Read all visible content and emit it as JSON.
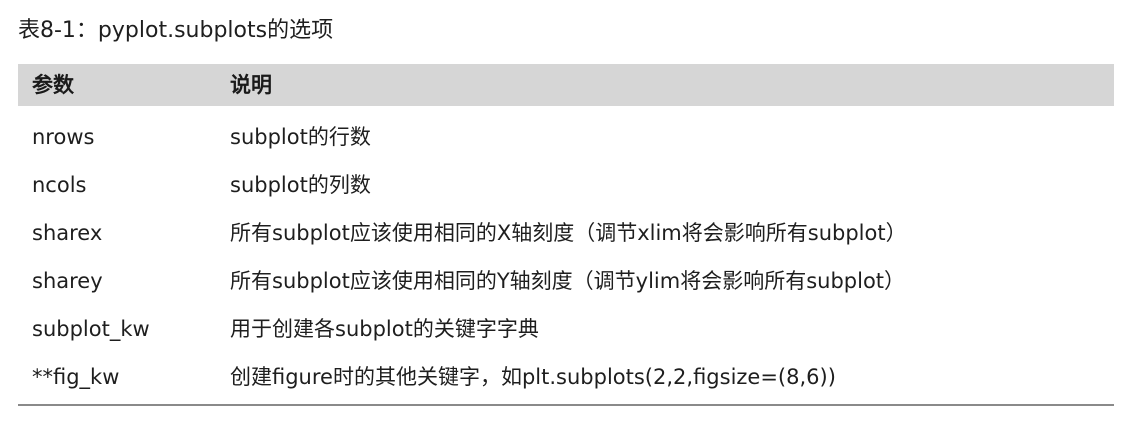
{
  "caption": "表8-1：pyplot.subplots的选项",
  "table": {
    "headers": [
      "参数",
      "说明"
    ],
    "rows": [
      {
        "param": "nrows",
        "desc": "subplot的行数"
      },
      {
        "param": "ncols",
        "desc": "subplot的列数"
      },
      {
        "param": "sharex",
        "desc": "所有subplot应该使用相同的X轴刻度（调节xlim将会影响所有subplot）"
      },
      {
        "param": "sharey",
        "desc": "所有subplot应该使用相同的Y轴刻度（调节ylim将会影响所有subplot）"
      },
      {
        "param": "subplot_kw",
        "desc": "用于创建各subplot的关键字字典"
      },
      {
        "param": "**fig_kw",
        "desc": "创建figure时的其他关键字，如plt.subplots(2,2,figsize=(8,6))"
      }
    ]
  },
  "colors": {
    "header_background": "#d6d6d6",
    "rule": "#8a8a8a",
    "text": "#1e1e1e"
  }
}
